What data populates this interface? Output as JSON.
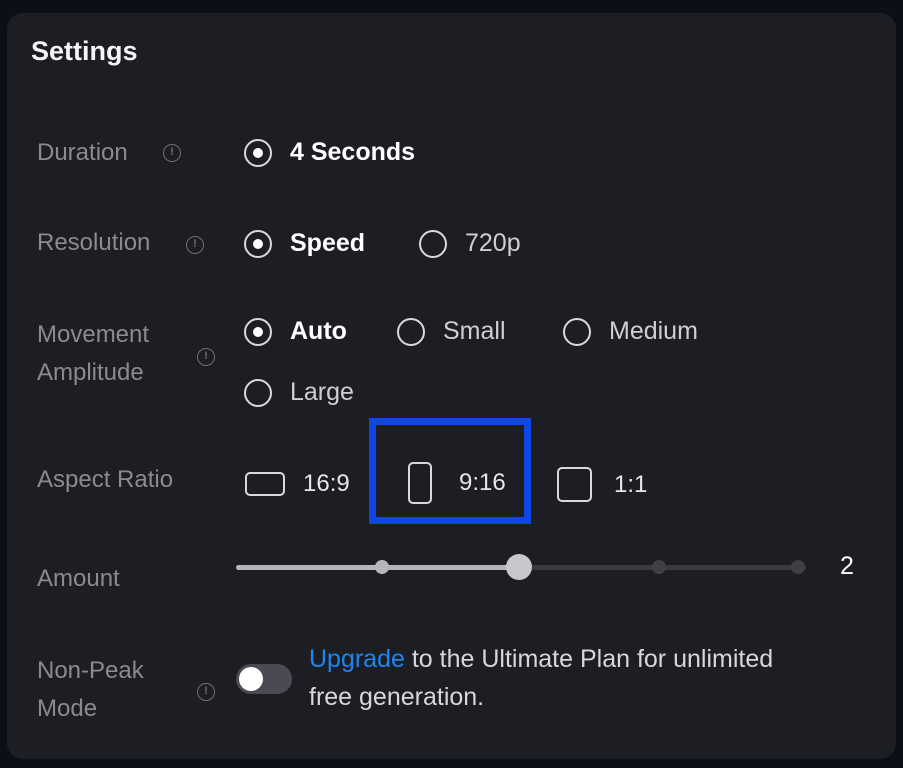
{
  "settings": {
    "title": "Settings",
    "duration": {
      "label": "Duration",
      "options": [
        {
          "label": "4 Seconds",
          "selected": true
        }
      ]
    },
    "resolution": {
      "label": "Resolution",
      "options": [
        {
          "label": "Speed",
          "selected": true
        },
        {
          "label": "720p",
          "selected": false
        }
      ]
    },
    "movement": {
      "label_line1": "Movement",
      "label_line2": "Amplitude",
      "options": [
        {
          "label": "Auto",
          "selected": true
        },
        {
          "label": "Small",
          "selected": false
        },
        {
          "label": "Medium",
          "selected": false
        },
        {
          "label": "Large",
          "selected": false
        }
      ]
    },
    "aspect_ratio": {
      "label": "Aspect Ratio",
      "options": [
        {
          "label": "16:9",
          "selected": false
        },
        {
          "label": "9:16",
          "selected": true
        },
        {
          "label": "1:1",
          "selected": false
        }
      ]
    },
    "amount": {
      "label": "Amount",
      "value": "2",
      "min": 1,
      "max": 4,
      "current": 2
    },
    "non_peak": {
      "label_line1": "Non-Peak",
      "label_line2": "Mode",
      "enabled": false,
      "link_text": "Upgrade",
      "rest_text": " to the Ultimate Plan for unlimited free generation."
    },
    "info_glyph": "!"
  },
  "colors": {
    "panel_bg": "#1d1e23",
    "highlight": "#1046e6",
    "link": "#1e84f0"
  }
}
